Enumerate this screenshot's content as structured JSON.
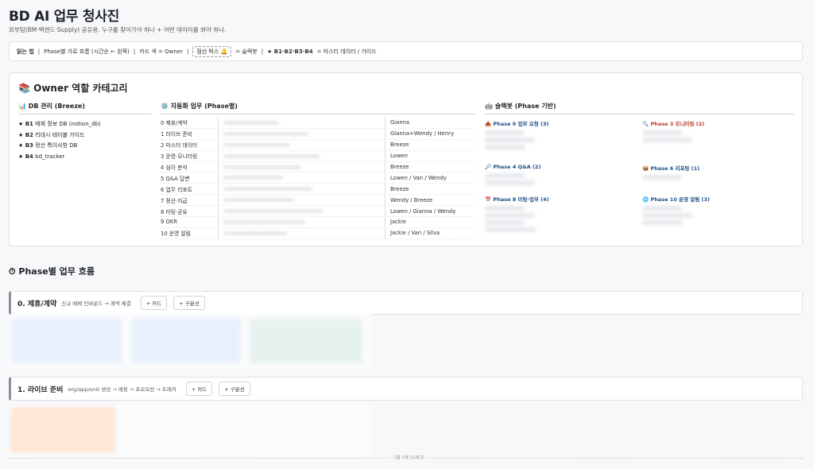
{
  "header": {
    "title": "BD AI 업무 청사진",
    "subtitle": "외부팀(BM·백엔드·Supply) 공유용. 누구를 찾아가야 하나 + 어떤 데이터를 봐야 하나."
  },
  "legend": {
    "read_label": "읽는 법",
    "flow": "Phase별 가로 흐름 (시간순 ← 왼쪽)",
    "card_color": "카드 색 = Owner",
    "dashed_box": "점선 박스 🔔",
    "dashed_meaning": "= 슬랙봇",
    "master": "★ B1·B2·B3·B4",
    "master_meaning": "= 마스터 데이터 / 가이드"
  },
  "owner": {
    "title": "📚 Owner 역할 카테고리",
    "db_head": "📊 DB 관리 (Breeze)",
    "db_items": [
      {
        "code": "★ B1",
        "label": "매체 정보 DB (notion_db)"
      },
      {
        "code": "★ B2",
        "label": "리대시 테이블 가이드"
      },
      {
        "code": "★ B3",
        "label": "정산 특이사항 DB"
      },
      {
        "code": "★ B4",
        "label": "bd_tracker"
      }
    ],
    "auto_head": "⚙️ 자동화 업무 (Phase별)",
    "auto_rows": [
      {
        "phase": "0 제휴/계약",
        "owner": "Gianna"
      },
      {
        "phase": "1 라이브 준비",
        "owner": "Gianna+Wendy / Henry"
      },
      {
        "phase": "2 마스터 데이터",
        "owner": "Breeze"
      },
      {
        "phase": "3 운영·모니터링",
        "owner": "Lowen"
      },
      {
        "phase": "4 심이 분석",
        "owner": "Breeze"
      },
      {
        "phase": "5 Q&A 답변",
        "owner": "Lowen / Van / Wendy"
      },
      {
        "phase": "6 업무 리포트",
        "owner": "Breeze"
      },
      {
        "phase": "7 정산·지급",
        "owner": "Wendy / Breeze"
      },
      {
        "phase": "8 미팅·공유",
        "owner": "Lowen / Gianna / Wendy"
      },
      {
        "phase": "9 OKR",
        "owner": "Jackie"
      },
      {
        "phase": "10 운영 알림",
        "owner": "Jackie / Van / Silva"
      }
    ],
    "slack_head": "🤖 슬랙봇 (Phase 기반)",
    "slack_items": [
      {
        "label": "📥 Phase 0 업무 요청 (3)",
        "color": "#1d4f8a"
      },
      {
        "label": "🔍 Phase 3 모니터링 (2)",
        "color": "#c0392b"
      },
      {
        "label": "🔎 Phase 4 Q&A (2)",
        "color": "#1d4f8a"
      },
      {
        "label": "📦 Phase 6 리포팅 (1)",
        "color": "#1d4f8a"
      },
      {
        "label": "📅 Phase 8 미팅·업무 (4)",
        "color": "#1d4f8a"
      },
      {
        "label": "🌐 Phase 10 운영 알림 (3)",
        "color": "#1d4f8a"
      }
    ]
  },
  "flow": {
    "title": "⏱ Phase별 업무 흐름",
    "phases": [
      {
        "name": "0. 제휴/계약",
        "desc": "신규 매체 인바운드 → 계약 체결",
        "add_card": "+ 카드",
        "add_sep": "+ 구분선"
      },
      {
        "name": "1. 라이브 준비",
        "desc": "org/app/unit 생성 → 매핑 → 프로모션 → 트래커",
        "add_card": "+ 카드",
        "add_sep": "+ 구분선"
      }
    ],
    "group_sep": "··· 그룹 구분 (드래그) ···"
  }
}
